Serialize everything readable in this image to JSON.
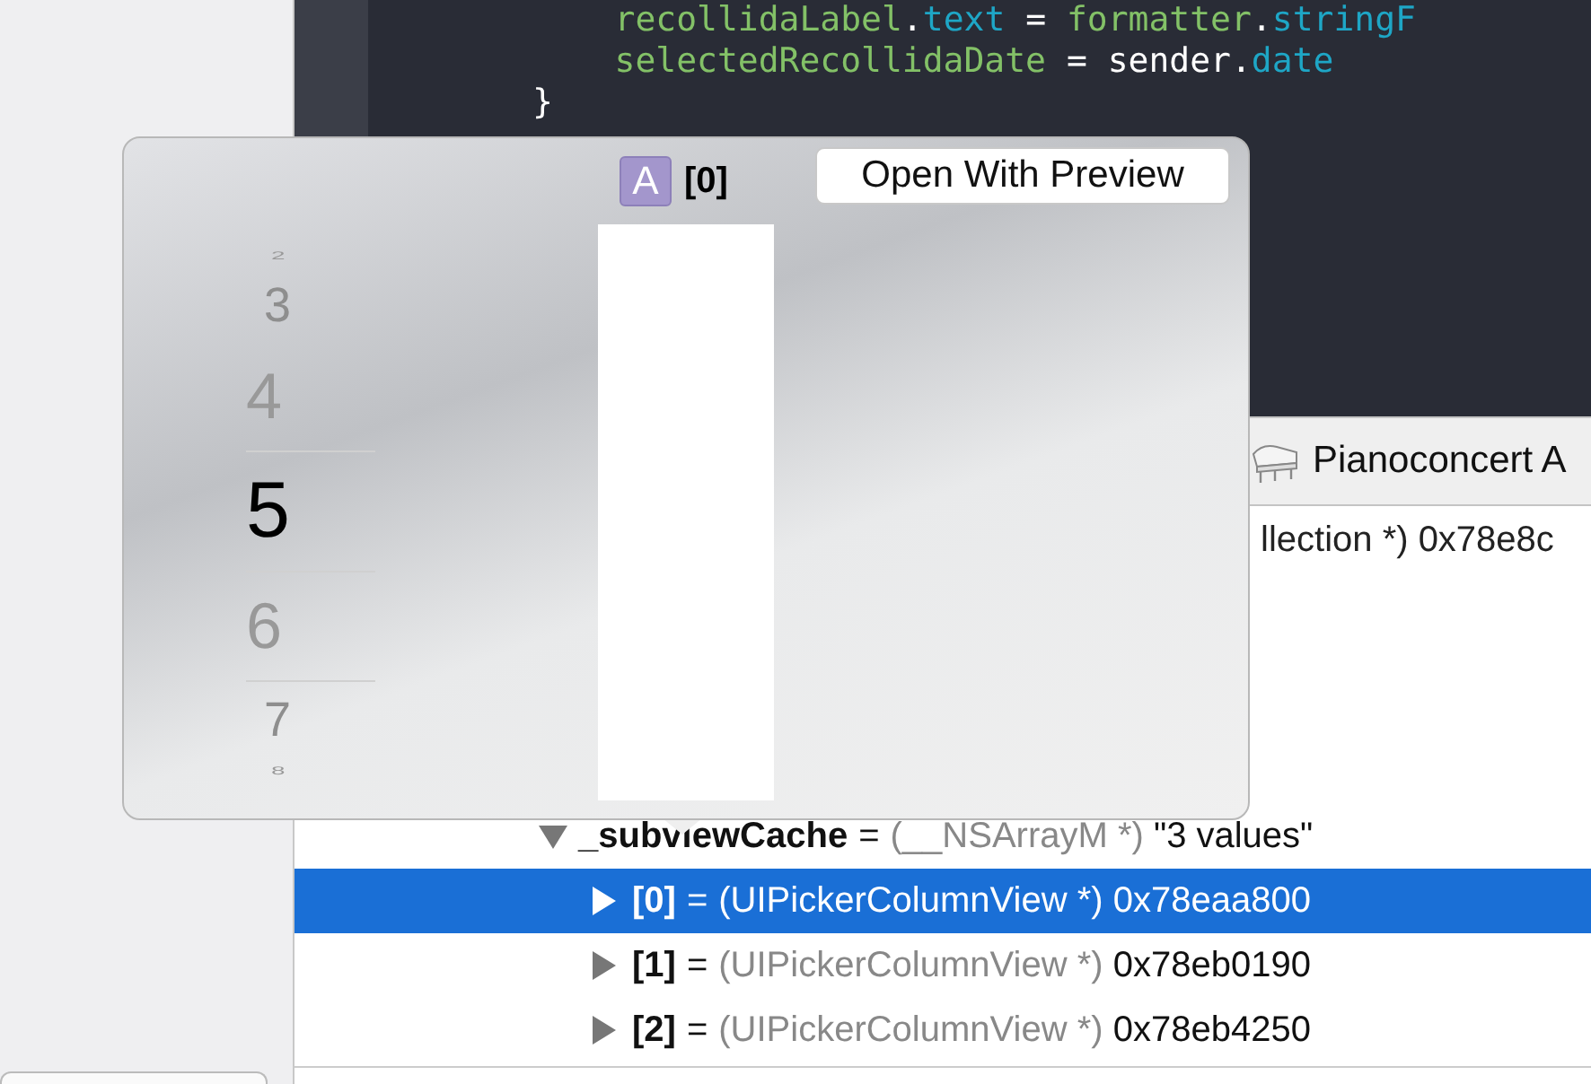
{
  "code_editor": {
    "lines": [
      {
        "tokens": [
          {
            "text": "            recollidaLabel",
            "kind": "variable"
          },
          {
            "text": ".",
            "kind": "plain"
          },
          {
            "text": "text",
            "kind": "property"
          },
          {
            "text": " = ",
            "kind": "plain"
          },
          {
            "text": "formatter",
            "kind": "variable"
          },
          {
            "text": ".",
            "kind": "plain"
          },
          {
            "text": "stringF",
            "kind": "property"
          }
        ]
      },
      {
        "tokens": [
          {
            "text": "            selectedRecollidaDate",
            "kind": "variable"
          },
          {
            "text": " = sender.",
            "kind": "plain"
          },
          {
            "text": "date",
            "kind": "property"
          }
        ]
      },
      {
        "tokens": [
          {
            "text": "        }",
            "kind": "plain"
          }
        ]
      }
    ]
  },
  "variables": {
    "partial_row": "llection *) 0x78e8c",
    "rows": [
      {
        "name": "_subviewCache",
        "operator": "=",
        "type": "(__NSArrayM *)",
        "value": "\"3 values\"",
        "expanded": true,
        "selected": false,
        "children": [
          {
            "name": "[0]",
            "operator": "=",
            "type": "(UIPickerColumnView *)",
            "value": "0x78eaa800",
            "expanded": false,
            "selected": true
          },
          {
            "name": "[1]",
            "operator": "=",
            "type": "(UIPickerColumnView *)",
            "value": "0x78eb0190",
            "expanded": false,
            "selected": false
          },
          {
            "name": "[2]",
            "operator": "=",
            "type": "(UIPickerColumnView *)",
            "value": "0x78eb4250",
            "expanded": false,
            "selected": false
          }
        ]
      }
    ]
  },
  "tooltip": {
    "text": "Pianoconcert A"
  },
  "popover": {
    "badge": "A",
    "title": "[0]",
    "button": "Open With Preview",
    "picker": [
      {
        "text": "2",
        "kind": "edge",
        "selected": false
      },
      {
        "text": "3",
        "kind": "far",
        "selected": false
      },
      {
        "text": "4",
        "kind": "near",
        "selected": false
      },
      {
        "text": "5",
        "kind": "center",
        "selected": true
      },
      {
        "text": "6",
        "kind": "near",
        "selected": false
      },
      {
        "text": "7",
        "kind": "far",
        "selected": false
      },
      {
        "text": "8",
        "kind": "edge",
        "selected": false
      }
    ]
  }
}
